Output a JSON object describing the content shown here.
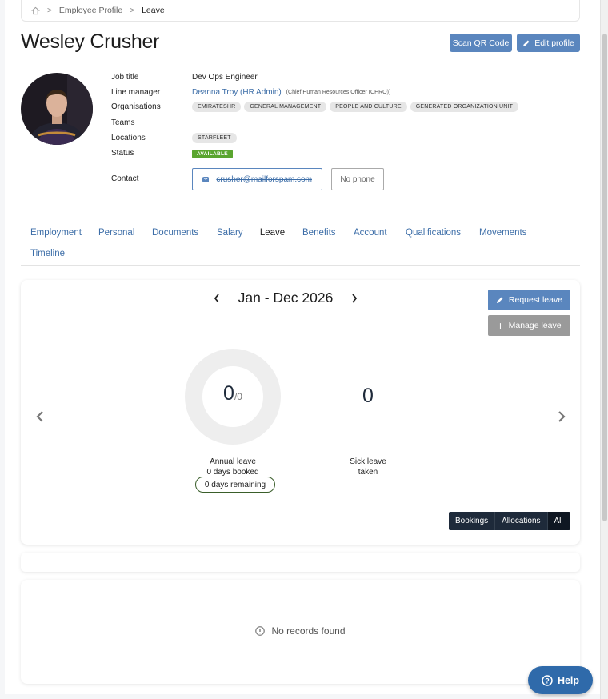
{
  "breadcrumb": {
    "home_icon": "home-icon",
    "items": [
      "Employee Profile",
      "Leave"
    ]
  },
  "profile": {
    "name": "Wesley Crusher",
    "scan_label": "Scan QR Code",
    "edit_label": "Edit profile",
    "fields": {
      "job_title_label": "Job title",
      "job_title": "Dev Ops Engineer",
      "line_manager_label": "Line manager",
      "line_manager": "Deanna Troy (HR Admin)",
      "line_manager_role": "(Chief Human Resources Officer (CHRO))",
      "organisations_label": "Organisations",
      "organisations": [
        "EMIRATESHR",
        "GENERAL MANAGEMENT",
        "PEOPLE AND CULTURE",
        "GENERATED ORGANIZATION UNIT"
      ],
      "teams_label": "Teams",
      "locations_label": "Locations",
      "location": "STARFLEET",
      "status_label": "Status",
      "status": "AVAILABLE",
      "contact_label": "Contact",
      "email": "crusher@mailforspam.com",
      "phone": "No phone"
    }
  },
  "tabs": [
    "Employment",
    "Personal",
    "Documents",
    "Salary",
    "Leave",
    "Benefits",
    "Account",
    "Qualifications",
    "Movements",
    "Timeline"
  ],
  "active_tab": "Leave",
  "leave": {
    "period": "Jan - Dec 2026",
    "request_label": "Request leave",
    "manage_label": "Manage leave",
    "annual": {
      "value": "0",
      "total": "/0",
      "caption": "Annual leave",
      "booked": "0 days booked",
      "remaining": "0 days remaining"
    },
    "sick": {
      "value": "0",
      "caption": "Sick leave",
      "sub": "taken"
    },
    "filters": [
      "Bookings",
      "Allocations",
      "All"
    ],
    "selected_filter": "All"
  },
  "records": {
    "empty_text": "No records found"
  },
  "help_label": "Help",
  "colors": {
    "primary": "#5a86be",
    "dark": "#1e2a3a",
    "status_green": "#5aa52f",
    "help": "#2f6aaa"
  }
}
